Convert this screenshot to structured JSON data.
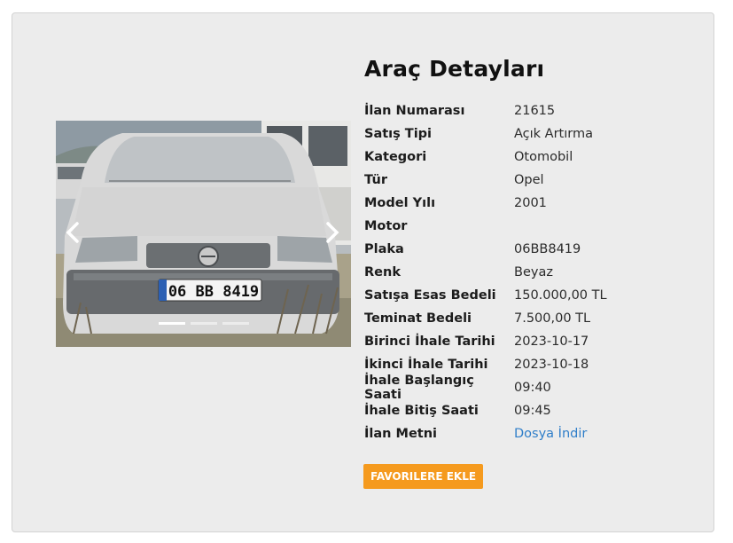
{
  "title": "Araç Detayları",
  "details": [
    {
      "label": "İlan Numarası",
      "value": "21615"
    },
    {
      "label": "Satış Tipi",
      "value": "Açık Artırma"
    },
    {
      "label": "Kategori",
      "value": "Otomobil"
    },
    {
      "label": "Tür",
      "value": "Opel"
    },
    {
      "label": "Model Yılı",
      "value": "2001"
    },
    {
      "label": "Motor",
      "value": ""
    },
    {
      "label": "Plaka",
      "value": "06BB8419"
    },
    {
      "label": "Renk",
      "value": "Beyaz"
    },
    {
      "label": "Satışa Esas Bedeli",
      "value": "150.000,00 TL"
    },
    {
      "label": "Teminat Bedeli",
      "value": "7.500,00 TL"
    },
    {
      "label": "Birinci İhale Tarihi",
      "value": "2023-10-17"
    },
    {
      "label": "İkinci İhale Tarihi",
      "value": "2023-10-18"
    },
    {
      "label": "İhale Başlangıç Saati",
      "value": "09:40"
    },
    {
      "label": "İhale Bitiş Saati",
      "value": "09:45"
    },
    {
      "label": "İlan Metni",
      "value": "Dosya İndir"
    }
  ],
  "carousel": {
    "plate_text": "06 BB 8419",
    "slide_count": 3,
    "active_slide": 1
  },
  "favorite_button": "FAVORILERE EKLE",
  "colors": {
    "accent": "#f59a1e",
    "link": "#2f7ec9",
    "card_bg": "#ececec"
  }
}
